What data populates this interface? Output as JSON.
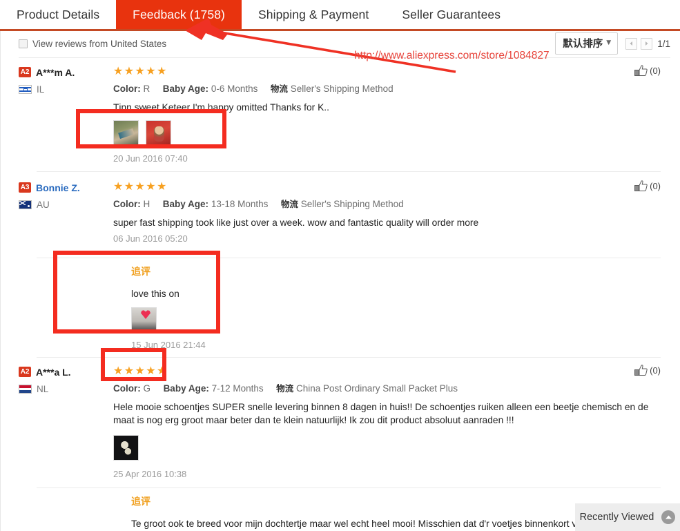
{
  "tabs": [
    {
      "label": "Product Details",
      "active": false
    },
    {
      "label": "Feedback (1758)",
      "active": true
    },
    {
      "label": "Shipping & Payment",
      "active": false
    },
    {
      "label": "Seller Guarantees",
      "active": false
    }
  ],
  "filter": {
    "checkbox_label": "View reviews from United States",
    "checked": false,
    "sort_label": "默认排序",
    "page_indicator": "1/1"
  },
  "annotation": {
    "url_text": "http://www.aliexpress.com/store/1084827",
    "color": "#f42c20"
  },
  "reviews": [
    {
      "level": "A2",
      "name": "A***m A.",
      "name_is_link": false,
      "country": "IL",
      "flag": "flag-il",
      "stars": "★★★★★",
      "color_label": "Color:",
      "color_value": "R",
      "age_label": "Baby Age:",
      "age_value": "0-6 Months",
      "logistics_icon": "物流",
      "logistics": "Seller's Shipping Method",
      "text": "Tjnn sweet Keteer I'm happy omitted Thanks for K..",
      "photos": [
        "th-a",
        "th-b"
      ],
      "date": "20 Jun 2016 07:40",
      "likes": "(0)",
      "additional": null
    },
    {
      "level": "A3",
      "name": "Bonnie Z.",
      "name_is_link": true,
      "country": "AU",
      "flag": "flag-au",
      "stars": "★★★★★",
      "color_label": "Color:",
      "color_value": "H",
      "age_label": "Baby Age:",
      "age_value": "13-18 Months",
      "logistics_icon": "物流",
      "logistics": "Seller's Shipping Method",
      "text": "super fast shipping took like just over a week. wow and fantastic quality will order more",
      "photos": [],
      "date": "06 Jun 2016 05:20",
      "likes": "(0)",
      "additional": {
        "title": "追评",
        "text": "love this on",
        "photos": [
          "th-c"
        ],
        "date": "15 Jun 2016 21:44"
      }
    },
    {
      "level": "A2",
      "name": "A***a L.",
      "name_is_link": false,
      "country": "NL",
      "flag": "flag-nl",
      "stars": "★★★★★",
      "color_label": "Color:",
      "color_value": "G",
      "age_label": "Baby Age:",
      "age_value": "7-12 Months",
      "logistics_icon": "物流",
      "logistics": "China Post Ordinary Small Packet Plus",
      "text": "Hele mooie schoentjes SUPER snelle levering binnen 8 dagen in huis!! De schoentjes ruiken alleen een beetje chemisch en de maat is nog erg groot maar beter dan te klein natuurlijk! Ik zou dit product absoluut aanraden !!!",
      "photos": [
        "th-d"
      ],
      "date": "25 Apr 2016 10:38",
      "likes": "(0)",
      "additional": {
        "title": "追评",
        "text": "Te groot ook te breed voor mijn dochtertje maar wel echt heel mooi! Misschien dat d'r voetjes binnenkort verande",
        "photos": [],
        "date": ""
      }
    }
  ],
  "recently_viewed": {
    "label": "Recently Viewed"
  }
}
